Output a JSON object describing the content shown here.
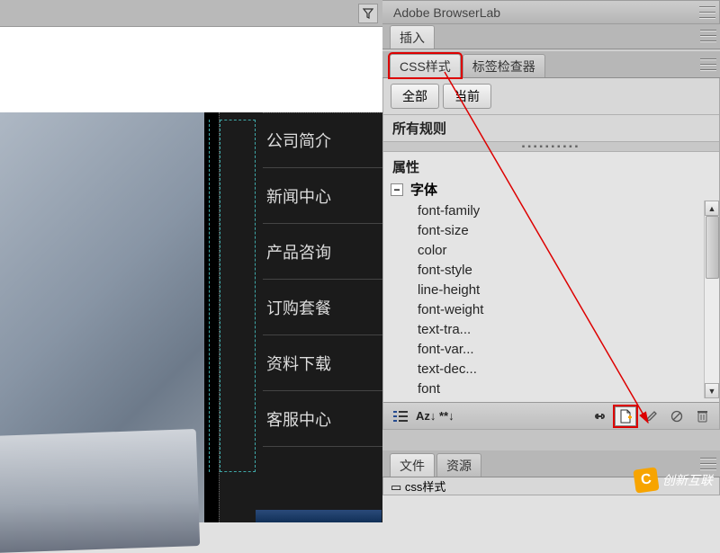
{
  "left": {
    "menu_items": [
      "公司简介",
      "新闻中心",
      "产品咨询",
      "订购套餐",
      "资料下载",
      "客服中心"
    ]
  },
  "panels": {
    "browserlab": "Adobe BrowserLab",
    "insert": "插入",
    "css_tab": "CSS样式",
    "tag_inspector": "标签检查器",
    "btn_all": "全部",
    "btn_current": "当前",
    "all_rules": "所有规则",
    "properties": "属性",
    "font_group": "字体",
    "font_props": [
      "font-family",
      "font-size",
      "color",
      "font-style",
      "line-height",
      "font-weight",
      "text-tra...",
      "font-var...",
      "text-dec...",
      "font"
    ],
    "az": "Az↓ **↓",
    "files_tab": "文件",
    "resources_tab": "资源",
    "csspanel": "css样式"
  },
  "icons": {
    "funnel": "funnel-icon",
    "list": "list-icon",
    "link": "link-icon",
    "newdoc": "new-document-icon",
    "pencil": "pencil-icon",
    "disable": "disable-icon",
    "trash": "trash-icon"
  },
  "watermark": "创新互联"
}
